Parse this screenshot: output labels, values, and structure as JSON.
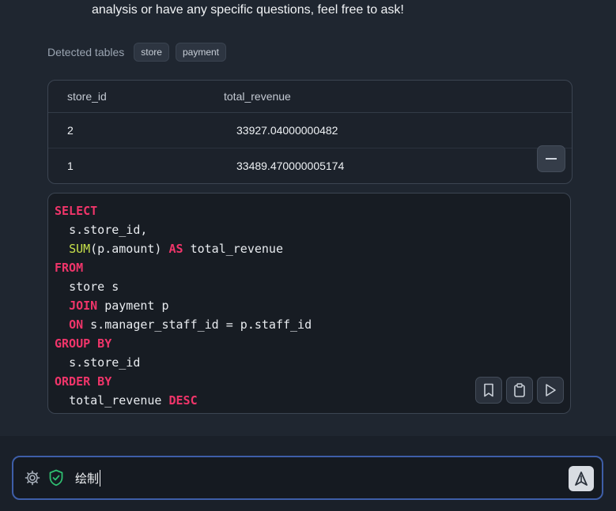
{
  "message": {
    "tail_text": "analysis or have any specific questions, feel free to ask!"
  },
  "detected_tables": {
    "label": "Detected tables",
    "tables": [
      "store",
      "payment"
    ]
  },
  "result_table": {
    "columns": [
      "store_id",
      "total_revenue"
    ],
    "rows": [
      [
        "2",
        "33927.04000000482"
      ],
      [
        "1",
        "33489.470000005174"
      ]
    ]
  },
  "sql": {
    "lines": [
      {
        "indent": "",
        "parts": [
          {
            "t": "SELECT",
            "k": "kw"
          }
        ]
      },
      {
        "indent": "  ",
        "parts": [
          {
            "t": "s.store_id,",
            "k": ""
          }
        ]
      },
      {
        "indent": "  ",
        "parts": [
          {
            "t": "SUM",
            "k": "fn"
          },
          {
            "t": "(p.amount) ",
            "k": ""
          },
          {
            "t": "AS",
            "k": "kw"
          },
          {
            "t": " total_revenue",
            "k": ""
          }
        ]
      },
      {
        "indent": "",
        "parts": [
          {
            "t": "FROM",
            "k": "kw"
          }
        ]
      },
      {
        "indent": "  ",
        "parts": [
          {
            "t": "store s",
            "k": ""
          }
        ]
      },
      {
        "indent": "  ",
        "parts": [
          {
            "t": "JOIN",
            "k": "kw"
          },
          {
            "t": " payment p",
            "k": ""
          }
        ]
      },
      {
        "indent": "  ",
        "parts": [
          {
            "t": "ON",
            "k": "kw"
          },
          {
            "t": " s.manager_staff_id = p.staff_id",
            "k": ""
          }
        ]
      },
      {
        "indent": "",
        "parts": [
          {
            "t": "GROUP BY",
            "k": "kw"
          }
        ]
      },
      {
        "indent": "  ",
        "parts": [
          {
            "t": "s.store_id",
            "k": ""
          }
        ]
      },
      {
        "indent": "",
        "parts": [
          {
            "t": "ORDER BY",
            "k": "kw"
          }
        ]
      },
      {
        "indent": "  ",
        "parts": [
          {
            "t": "total_revenue ",
            "k": ""
          },
          {
            "t": "DESC",
            "k": "kw"
          }
        ]
      }
    ],
    "actions": [
      "bookmark-icon",
      "clipboard-icon",
      "play-icon"
    ]
  },
  "input": {
    "value": "绘制",
    "icons": [
      "gear-icon",
      "shield-check-icon",
      "send-icon"
    ]
  },
  "colors": {
    "keyword": "#f0356a",
    "function": "#c8e14a",
    "shield": "#2fbf71",
    "input_border": "#3e5ea8"
  }
}
